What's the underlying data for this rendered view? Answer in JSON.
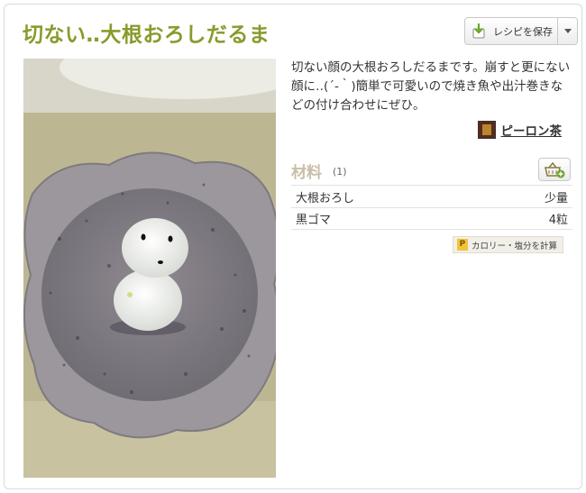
{
  "recipe": {
    "title": "切ない‥大根おろしだるま",
    "description": "切ない顔の大根おろしだるまです。崩すと更にない顔に‥(´-｀)簡単で可愛いので焼き魚や出汁巻きなどの付け合わせにぜひ。",
    "author": "ピーロン茶"
  },
  "save_button": {
    "label": "レシピを保存",
    "icon": "save-recipe-icon"
  },
  "ingredients": {
    "title": "材料",
    "servings": "(1)",
    "items": [
      {
        "name": "大根おろし",
        "amount": "少量"
      },
      {
        "name": "黒ゴマ",
        "amount": "4粒"
      }
    ]
  },
  "calorie_button": {
    "label": "カロリー・塩分を計算",
    "icon_letter": "P"
  },
  "colors": {
    "title": "#8a9a2c",
    "ingredients_title": "#c9bea8",
    "accent_calorie": "#f5c23a"
  }
}
